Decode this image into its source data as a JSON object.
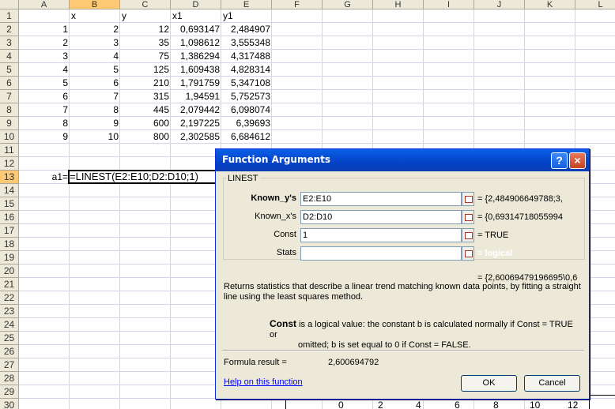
{
  "sheet": {
    "columns": [
      "A",
      "B",
      "C",
      "D",
      "E",
      "F",
      "G",
      "H",
      "I",
      "J",
      "K",
      "L"
    ],
    "rows": [
      "1",
      "2",
      "3",
      "4",
      "5",
      "6",
      "7",
      "8",
      "9",
      "10",
      "11",
      "12",
      "13",
      "14",
      "15",
      "16",
      "17",
      "18",
      "19",
      "20",
      "21",
      "22",
      "23",
      "24",
      "25",
      "26",
      "27",
      "28",
      "29",
      "30"
    ],
    "headers": {
      "b": "x",
      "c": "y",
      "d": "x1",
      "e": "y1"
    },
    "data": [
      [
        "1",
        "2",
        "12",
        "0,693147",
        "2,484907"
      ],
      [
        "2",
        "3",
        "35",
        "1,098612",
        "3,555348"
      ],
      [
        "3",
        "4",
        "75",
        "1,386294",
        "4,317488"
      ],
      [
        "4",
        "5",
        "125",
        "1,609438",
        "4,828314"
      ],
      [
        "5",
        "6",
        "210",
        "1,791759",
        "5,347108"
      ],
      [
        "6",
        "7",
        "315",
        "1,94591",
        "5,752573"
      ],
      [
        "7",
        "8",
        "445",
        "2,079442",
        "6,098074"
      ],
      [
        "8",
        "9",
        "600",
        "2,197225",
        "6,39693"
      ],
      [
        "9",
        "10",
        "800",
        "2,302585",
        "6,684612"
      ]
    ],
    "a13_label": "a1=",
    "b13_formula": "=LINEST(E2:E10;D2:D10;1)",
    "chart_ticks": [
      "0",
      "2",
      "4",
      "6",
      "8",
      "10",
      "12"
    ]
  },
  "dialog": {
    "title": "Function Arguments",
    "help_button": "?",
    "close_button": "×",
    "function_name": "LINEST",
    "args": [
      {
        "label": "Known_y's",
        "value": "E2:E10",
        "result": "= {2,484906649788;3,"
      },
      {
        "label": "Known_x's",
        "value": "D2:D10",
        "result": "= {0,69314718055994"
      },
      {
        "label": "Const",
        "value": "1",
        "result": "= TRUE"
      },
      {
        "label": "Stats",
        "value": "",
        "result": "= logical"
      }
    ],
    "overall_result": "= {2,60069479196695\\0,6",
    "description": "Returns statistics that describe a linear trend matching known data points, by fitting a straight line using the least squares method.",
    "arg_help_name": "Const",
    "arg_help_text": "is a logical value: the constant b is calculated normally if Const = TRUE or",
    "arg_help_cont": "omitted; b is set equal to 0 if Const = FALSE.",
    "formula_result_label": "Formula result =",
    "formula_result_value": "2,600694792",
    "help_link": "Help on this function",
    "ok_label": "OK",
    "cancel_label": "Cancel"
  }
}
